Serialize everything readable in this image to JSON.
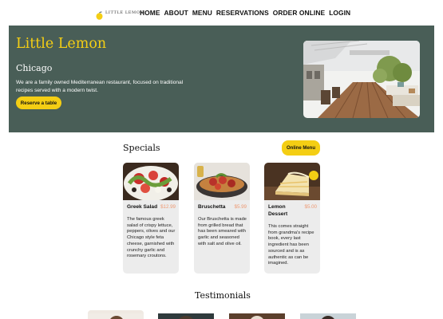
{
  "brand": {
    "name": "LITTLE LEMON",
    "icon": "lemon-icon",
    "color": "#f4ce14"
  },
  "nav": {
    "items": [
      "HOME",
      "ABOUT",
      "MENU",
      "RESERVATIONS",
      "ORDER ONLINE",
      "LOGIN"
    ]
  },
  "hero": {
    "title": "Little Lemon",
    "city": "Chicago",
    "description": "We are a family owned Mediterranean restaurant, focused on traditional recipes served with a modern twist.",
    "cta": "Reserve a table",
    "image": "restaurant-terrace-photo",
    "background": "#495e57"
  },
  "specials": {
    "title": "Specials",
    "button": "Online Menu",
    "items": [
      {
        "name": "Greek Salad",
        "price": "$12.99",
        "image": "greek-salad-photo",
        "description": "The famous greek salad of crispy lettuce, peppers, olives and our Chicago style feta cheese, garnished with crunchy garlic and rosemary croutons."
      },
      {
        "name": "Bruschetta",
        "price": "$5.99",
        "image": "bruschetta-photo",
        "description": "Our Bruschetta is made from grilled bread that has been smeared with garlic and seasoned with salt and olive oil."
      },
      {
        "name": "Lemon Dessert",
        "price": "$5.00",
        "image": "lemon-dessert-photo",
        "description": "This comes straight from grandma's recipe book, every last ingredient has been sourced and is as authentic as can be imagined."
      }
    ]
  },
  "testimonials": {
    "title": "Testimonials",
    "items": [
      "testimonial-photo-1",
      "testimonial-photo-2",
      "testimonial-photo-3",
      "testimonial-photo-4"
    ]
  }
}
